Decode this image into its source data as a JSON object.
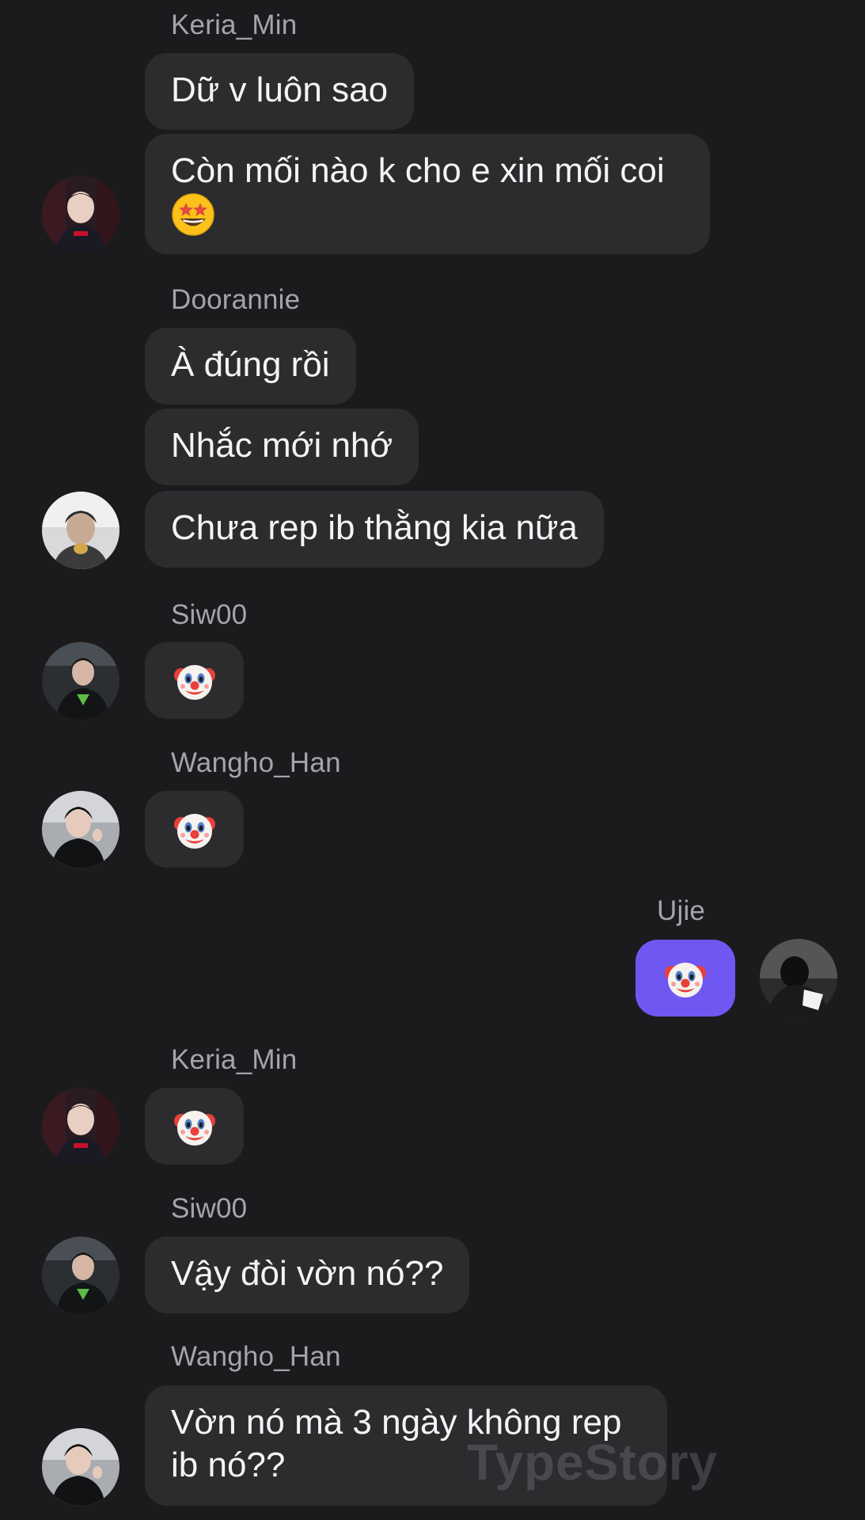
{
  "messages": [
    {
      "sender": "Keria_Min",
      "texts": [
        "Dữ v luôn sao",
        "Còn mối nào k cho e xin mối coi"
      ],
      "emoji": "star-struck"
    },
    {
      "sender": "Doorannie",
      "texts": [
        "À đúng rồi",
        "Nhắc mới nhớ",
        "Chưa rep ib thằng kia nữa"
      ]
    },
    {
      "sender": "Siw00",
      "emoji": "clown-face"
    },
    {
      "sender": "Wangho_Han",
      "emoji": "clown-face"
    },
    {
      "sender": "Ujie",
      "emoji": "clown-face",
      "own": true
    },
    {
      "sender": "Keria_Min",
      "emoji": "clown-face"
    },
    {
      "sender": "Siw00",
      "texts": [
        "Vậy đòi vờn nó??"
      ]
    },
    {
      "sender": "Wangho_Han",
      "texts": [
        "Vờn nó mà 3 ngày không rep ib nó??"
      ]
    }
  ],
  "watermark": "TypeStory",
  "colors": {
    "background": "#1b1b1d",
    "bubble": "#2c2c2f",
    "own_bubble": "#7157f2",
    "sender_name": "#a4a4ab",
    "text": "#f4f4f6"
  }
}
